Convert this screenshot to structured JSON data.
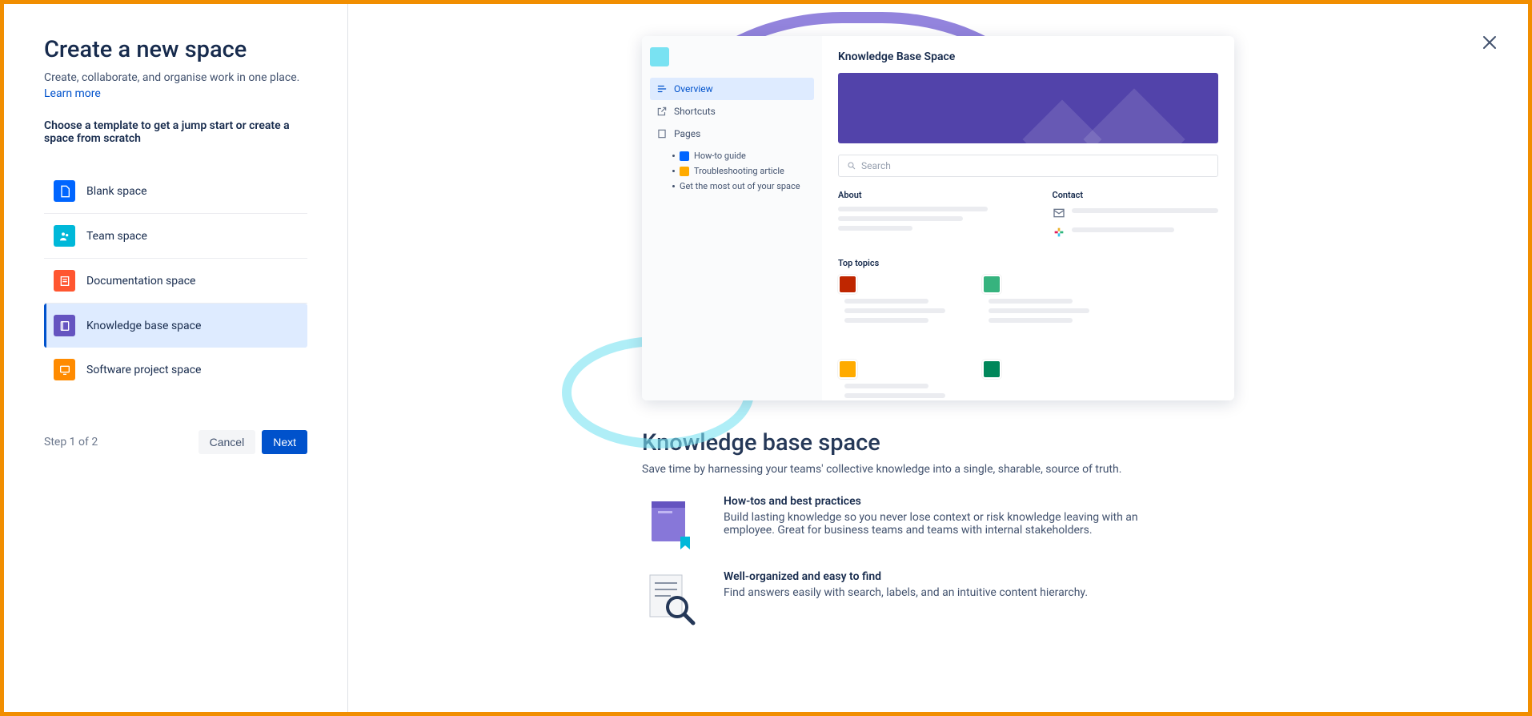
{
  "left": {
    "title": "Create a new space",
    "subtitle": "Create, collaborate, and organise work in one place.",
    "learn_more": "Learn more",
    "template_prompt": "Choose a template to get a jump start or create a space from scratch"
  },
  "templates": [
    {
      "label": "Blank space",
      "icon": "page-icon",
      "color": "#0065ff",
      "selected": false
    },
    {
      "label": "Team space",
      "icon": "people-icon",
      "color": "#00b8d9",
      "selected": false
    },
    {
      "label": "Documentation space",
      "icon": "doc-icon",
      "color": "#ff5630",
      "selected": false
    },
    {
      "label": "Knowledge base space",
      "icon": "book-icon",
      "color": "#6554c0",
      "selected": true
    },
    {
      "label": "Software project space",
      "icon": "monitor-icon",
      "color": "#ff8b00",
      "selected": false
    }
  ],
  "footer": {
    "step": "Step 1 of 2",
    "cancel": "Cancel",
    "next": "Next"
  },
  "preview": {
    "space_title": "Knowledge Base Space",
    "nav": {
      "overview": "Overview",
      "shortcuts": "Shortcuts",
      "pages": "Pages"
    },
    "pages": [
      "How-to guide",
      "Troubleshooting article",
      "Get the most out of your space"
    ],
    "search_placeholder": "Search",
    "about_label": "About",
    "contact_label": "Contact",
    "top_topics_label": "Top topics",
    "topic_colors": [
      "#bf2600",
      "#36b37e",
      "#ffab00",
      "#00875a",
      "#ff7452",
      "#6554c0"
    ]
  },
  "right": {
    "title": "Knowledge base space",
    "desc": "Save time by harnessing your teams' collective knowledge into a single, sharable, source of truth.",
    "features": [
      {
        "title": "How-tos and best practices",
        "desc": "Build lasting knowledge so you never lose context or risk knowledge leaving with an employee. Great for business teams and teams with internal stakeholders."
      },
      {
        "title": "Well-organized and easy to find",
        "desc": "Find answers easily with search, labels, and an intuitive content hierarchy."
      }
    ]
  }
}
